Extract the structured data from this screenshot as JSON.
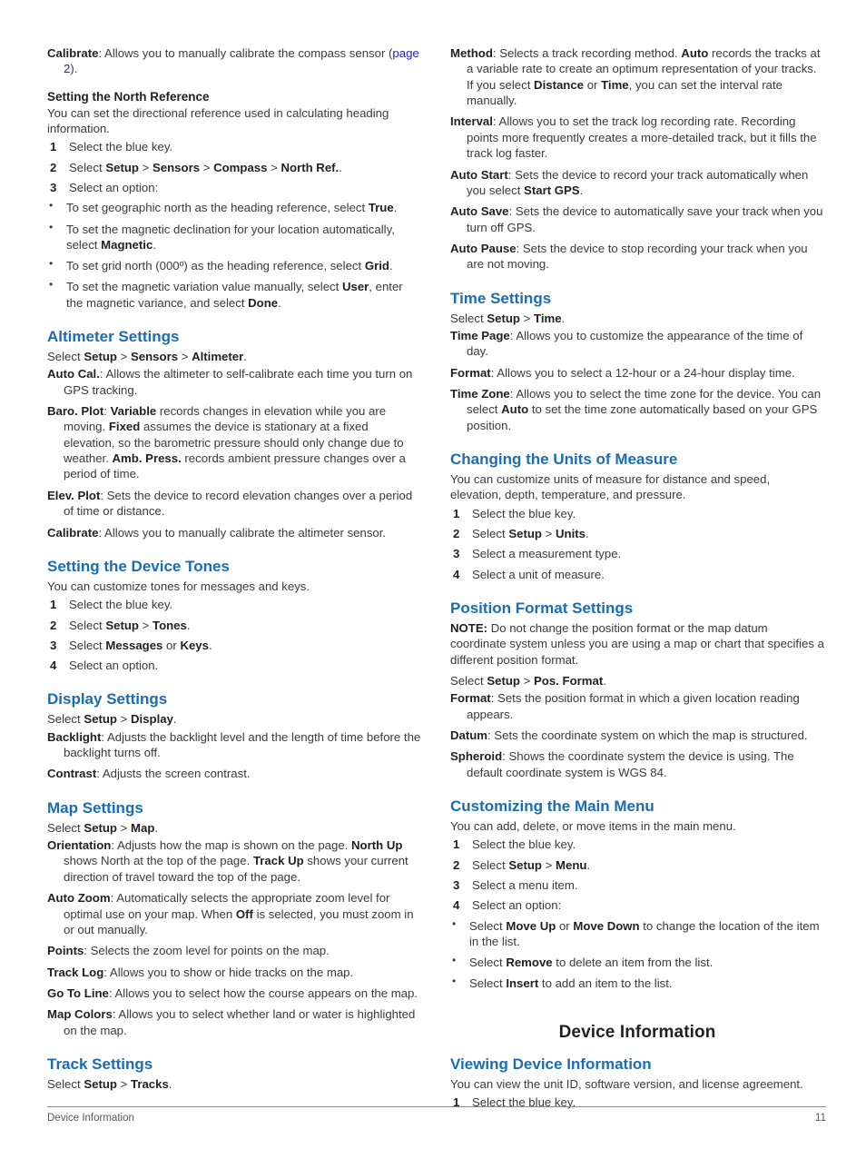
{
  "colors": {
    "heading_blue": "#1b6cb0",
    "link_blue": "#2222cc",
    "body_text": "#3a3a3c",
    "bold_text": "#231f20",
    "rule": "#8a8a8a"
  },
  "left_column": {
    "calibrate_def": {
      "term": "Calibrate",
      "text_before_link": ": Allows you to manually calibrate the compass sensor (",
      "link": "page 2",
      "text_after_link": ")."
    },
    "north_reference": {
      "heading": "Setting the North Reference",
      "intro": "You can set the directional reference used in calculating heading information.",
      "steps": [
        "Select the blue key.",
        "Select Setup > Sensors > Compass > North Ref..",
        "Select an option:"
      ],
      "step2_parts": {
        "prefix": "Select ",
        "b1": "Setup",
        "sep1": " > ",
        "b2": "Sensors",
        "sep2": " > ",
        "b3": "Compass",
        "sep3": " > ",
        "b4": "North Ref.",
        "suffix": "."
      },
      "options": [
        {
          "before": "To set geographic north as the heading reference, select ",
          "bold": "True",
          "after": "."
        },
        {
          "before": "To set the magnetic declination for your location automatically, select ",
          "bold": "Magnetic",
          "after": "."
        },
        {
          "before": "To set grid north (000º) as the heading reference, select ",
          "bold": "Grid",
          "after": "."
        },
        {
          "before": "To set the magnetic variation value manually, select ",
          "bold": "User",
          "after": ", enter the magnetic variance, and select ",
          "bold2": "Done",
          "after2": "."
        }
      ]
    },
    "altimeter_settings": {
      "heading": "Altimeter Settings",
      "path": {
        "prefix": "Select ",
        "b1": "Setup",
        "sep1": " > ",
        "b2": "Sensors",
        "sep2": " > ",
        "b3": "Altimeter",
        "suffix": "."
      },
      "definitions": [
        {
          "term": "Auto Cal.",
          "text": ": Allows the altimeter to self-calibrate each time you turn on GPS tracking."
        },
        {
          "term": "Baro. Plot",
          "text_a": ": ",
          "b_a": "Variable",
          "text_b": " records changes in elevation while you are moving. ",
          "b_b": "Fixed",
          "text_c": " assumes the device is stationary at a fixed elevation, so the barometric pressure should only change due to weather. ",
          "b_c": "Amb. Press.",
          "text_d": " records ambient pressure changes over a period of time."
        },
        {
          "term": "Elev. Plot",
          "text": ": Sets the device to record elevation changes over a period of time or distance."
        },
        {
          "term": "Calibrate",
          "text": ": Allows you to manually calibrate the altimeter sensor."
        }
      ]
    },
    "device_tones": {
      "heading": "Setting the Device Tones",
      "intro": "You can customize tones for messages and keys.",
      "steps": [
        {
          "text": "Select the blue key."
        },
        {
          "prefix": "Select ",
          "b1": "Setup",
          "sep1": " > ",
          "b2": "Tones",
          "suffix": "."
        },
        {
          "prefix": "Select ",
          "b1": "Messages",
          "sep1": " or ",
          "b2": "Keys",
          "suffix": "."
        },
        {
          "text": "Select an option."
        }
      ]
    },
    "display_settings": {
      "heading": "Display Settings",
      "path": {
        "prefix": "Select ",
        "b1": "Setup",
        "sep1": " > ",
        "b2": "Display",
        "suffix": "."
      },
      "definitions": [
        {
          "term": "Backlight",
          "text": ": Adjusts the backlight level and the length of time before the backlight turns off."
        },
        {
          "term": "Contrast",
          "text": ": Adjusts the screen contrast."
        }
      ]
    },
    "map_settings": {
      "heading": "Map Settings",
      "path": {
        "prefix": "Select ",
        "b1": "Setup",
        "sep1": " > ",
        "b2": "Map",
        "suffix": "."
      },
      "definitions": [
        {
          "term": "Orientation",
          "text_a": ": Adjusts how the map is shown on the page. ",
          "b_a": "North Up",
          "text_b": " shows North at the top of the page. ",
          "b_b": "Track Up",
          "text_c": " shows your current direction of travel toward the top of the page."
        },
        {
          "term": "Auto Zoom",
          "text_a": ": Automatically selects the appropriate zoom level for optimal use on your map. When ",
          "b_a": "Off",
          "text_b": " is selected, you must zoom in or out manually."
        },
        {
          "term": "Points",
          "text": ": Selects the zoom level for points on the map."
        },
        {
          "term": "Track Log",
          "text": ": Allows you to show or hide tracks on the map."
        },
        {
          "term": "Go To Line",
          "text": ": Allows you to select how the course appears on the map."
        },
        {
          "term": "Map Colors",
          "text": ": Allows you to select whether land or water is highlighted on the map."
        }
      ]
    },
    "track_settings": {
      "heading": "Track Settings",
      "path": {
        "prefix": "Select ",
        "b1": "Setup",
        "sep1": " > ",
        "b2": "Tracks",
        "suffix": "."
      }
    }
  },
  "right_column": {
    "track_definitions": [
      {
        "term": "Method",
        "text_a": ": Selects a track recording method. ",
        "b_a": "Auto",
        "text_b": " records the tracks at a variable rate to create an optimum representation of your tracks. If you select ",
        "b_b": "Distance",
        "text_c": " or ",
        "b_c": "Time",
        "text_d": ", you can set the interval rate manually."
      },
      {
        "term": "Interval",
        "text": ": Allows you to set the track log recording rate. Recording points more frequently creates a more-detailed track, but it fills the track log faster."
      },
      {
        "term": "Auto Start",
        "text_a": ": Sets the device to record your track automatically when you select ",
        "b_a": "Start GPS",
        "text_b": "."
      },
      {
        "term": "Auto Save",
        "text": ": Sets the device to automatically save your track when you turn off GPS."
      },
      {
        "term": "Auto Pause",
        "text": ": Sets the device to stop recording your track when you are not moving."
      }
    ],
    "time_settings": {
      "heading": "Time Settings",
      "path": {
        "prefix": "Select ",
        "b1": "Setup",
        "sep1": " > ",
        "b2": "Time",
        "suffix": "."
      },
      "definitions": [
        {
          "term": "Time Page",
          "text": ": Allows you to customize the appearance of the time of day."
        },
        {
          "term": "Format",
          "text": ": Allows you to select a 12-hour or a 24-hour display time."
        },
        {
          "term": "Time Zone",
          "text_a": ": Allows you to select the time zone for the device. You can select ",
          "b_a": "Auto",
          "text_b": " to set the time zone automatically based on your GPS position."
        }
      ]
    },
    "units_of_measure": {
      "heading": "Changing the Units of Measure",
      "intro": "You can customize units of measure for distance and speed, elevation, depth, temperature, and pressure.",
      "steps": [
        {
          "text": "Select the blue key."
        },
        {
          "prefix": "Select ",
          "b1": "Setup",
          "sep1": " > ",
          "b2": "Units",
          "suffix": "."
        },
        {
          "text": "Select a measurement type."
        },
        {
          "text": "Select a unit of measure."
        }
      ]
    },
    "position_format": {
      "heading": "Position Format Settings",
      "note_label": "NOTE:",
      "note_text": " Do not change the position format or the map datum coordinate system unless you are using a map or chart that specifies a different position format.",
      "path": {
        "prefix": "Select ",
        "b1": "Setup",
        "sep1": " > ",
        "b2": "Pos. Format",
        "suffix": "."
      },
      "definitions": [
        {
          "term": "Format",
          "text": ": Sets the position format in which a given location reading appears."
        },
        {
          "term": "Datum",
          "text": ": Sets the coordinate system on which the map is structured."
        },
        {
          "term": "Spheroid",
          "text": ": Shows the coordinate system the device is using. The default coordinate system is WGS 84."
        }
      ]
    },
    "main_menu": {
      "heading": "Customizing the Main Menu",
      "intro": "You can add, delete, or move items in the main menu.",
      "steps": [
        {
          "text": "Select the blue key."
        },
        {
          "prefix": "Select ",
          "b1": "Setup",
          "sep1": " > ",
          "b2": "Menu",
          "suffix": "."
        },
        {
          "text": "Select a menu item."
        },
        {
          "text": "Select an option:"
        }
      ],
      "options": [
        {
          "before": "Select ",
          "bold": "Move Up",
          "after": " or ",
          "bold2": "Move Down",
          "after2": " to change the location of the item in the list."
        },
        {
          "before": "Select ",
          "bold": "Remove",
          "after": " to delete an item from the list."
        },
        {
          "before": "Select ",
          "bold": "Insert",
          "after": " to add an item to the list."
        }
      ]
    },
    "device_information": {
      "title": "Device Information",
      "heading": "Viewing Device Information",
      "intro": "You can view the unit ID, software version, and license agreement.",
      "steps": [
        {
          "text": "Select the blue key."
        }
      ]
    }
  },
  "footer": {
    "left": "Device Information",
    "page_number": "11"
  }
}
